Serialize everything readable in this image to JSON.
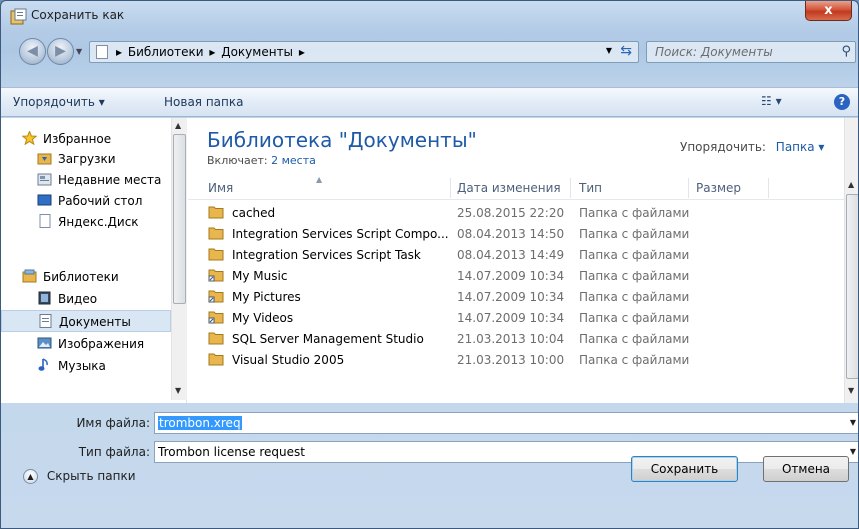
{
  "window": {
    "title": "Сохранить как",
    "close_glyph": "x"
  },
  "address": {
    "crumbs": [
      "Библиотеки",
      "Документы"
    ],
    "separator": "▸",
    "search_placeholder": "Поиск: Документы"
  },
  "toolbar": {
    "organize": "Упорядочить ▾",
    "new_folder": "Новая папка",
    "view_glyph": "☷ ▾",
    "help_glyph": "?"
  },
  "nav": {
    "favorites": {
      "label": "Избранное",
      "items": [
        "Загрузки",
        "Недавние места",
        "Рабочий стол",
        "Яндекс.Диск"
      ]
    },
    "libraries": {
      "label": "Библиотеки",
      "items": [
        "Видео",
        "Документы",
        "Изображения",
        "Музыка"
      ],
      "selected": "Документы"
    }
  },
  "library": {
    "title": "Библиотека \"Документы\"",
    "includes_label": "Включает:",
    "includes_link": "2 места",
    "arrange_label": "Упорядочить:",
    "arrange_value": "Папка ▾"
  },
  "columns": [
    "Имя",
    "Дата изменения",
    "Тип",
    "Размер"
  ],
  "rows": [
    {
      "name": "cached",
      "date": "25.08.2015 22:20",
      "type": "Папка с файлами",
      "icon": "folder"
    },
    {
      "name": "Integration Services Script Compo...",
      "date": "08.04.2013 14:50",
      "type": "Папка с файлами",
      "icon": "folder"
    },
    {
      "name": "Integration Services Script Task",
      "date": "08.04.2013 14:49",
      "type": "Папка с файлами",
      "icon": "folder"
    },
    {
      "name": "My Music",
      "date": "14.07.2009 10:34",
      "type": "Папка с файлами",
      "icon": "shortcut-folder"
    },
    {
      "name": "My Pictures",
      "date": "14.07.2009 10:34",
      "type": "Папка с файлами",
      "icon": "shortcut-folder"
    },
    {
      "name": "My Videos",
      "date": "14.07.2009 10:34",
      "type": "Папка с файлами",
      "icon": "shortcut-folder"
    },
    {
      "name": "SQL Server Management Studio",
      "date": "21.03.2013 10:04",
      "type": "Папка с файлами",
      "icon": "folder"
    },
    {
      "name": "Visual Studio 2005",
      "date": "21.03.2013 10:00",
      "type": "Папка с файлами",
      "icon": "folder"
    }
  ],
  "form": {
    "filename_label": "Имя файла:",
    "filename_value": "trombon.xreq",
    "filetype_label": "Тип файла:",
    "filetype_value": "Trombon license request"
  },
  "footer": {
    "hide_folders": "Скрыть папки",
    "save": "Сохранить",
    "cancel": "Отмена"
  },
  "colors": {
    "accent": "#1e5aa8",
    "selection": "#3399ff",
    "close": "#c0391f",
    "folder": "#e8b64c"
  }
}
